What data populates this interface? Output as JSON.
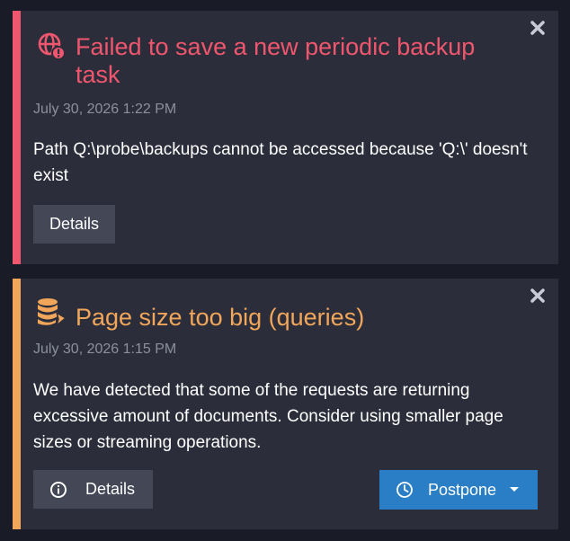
{
  "notifications": [
    {
      "title": "Failed to save a new periodic backup task",
      "timestamp": "July 30, 2026 1:22 PM",
      "message": "Path Q:\\probe\\backups cannot be accessed because 'Q:\\' doesn't exist",
      "details_label": "Details",
      "accent_color": "#f0566e",
      "icon": "globe-error-icon"
    },
    {
      "title": "Page size too big (queries)",
      "timestamp": "July 30, 2026 1:15 PM",
      "message": "We have detected that some of the requests are returning excessive amount of documents. Consider using smaller page sizes or streaming operations.",
      "details_label": "Details",
      "postpone_label": "Postpone",
      "accent_color": "#f2a65a",
      "icon": "database-alert-icon"
    }
  ],
  "colors": {
    "background": "#191b26",
    "card": "#2b2e3a",
    "button": "#434756",
    "postpone": "#2a7ec6",
    "timestamp": "#8c909d"
  }
}
